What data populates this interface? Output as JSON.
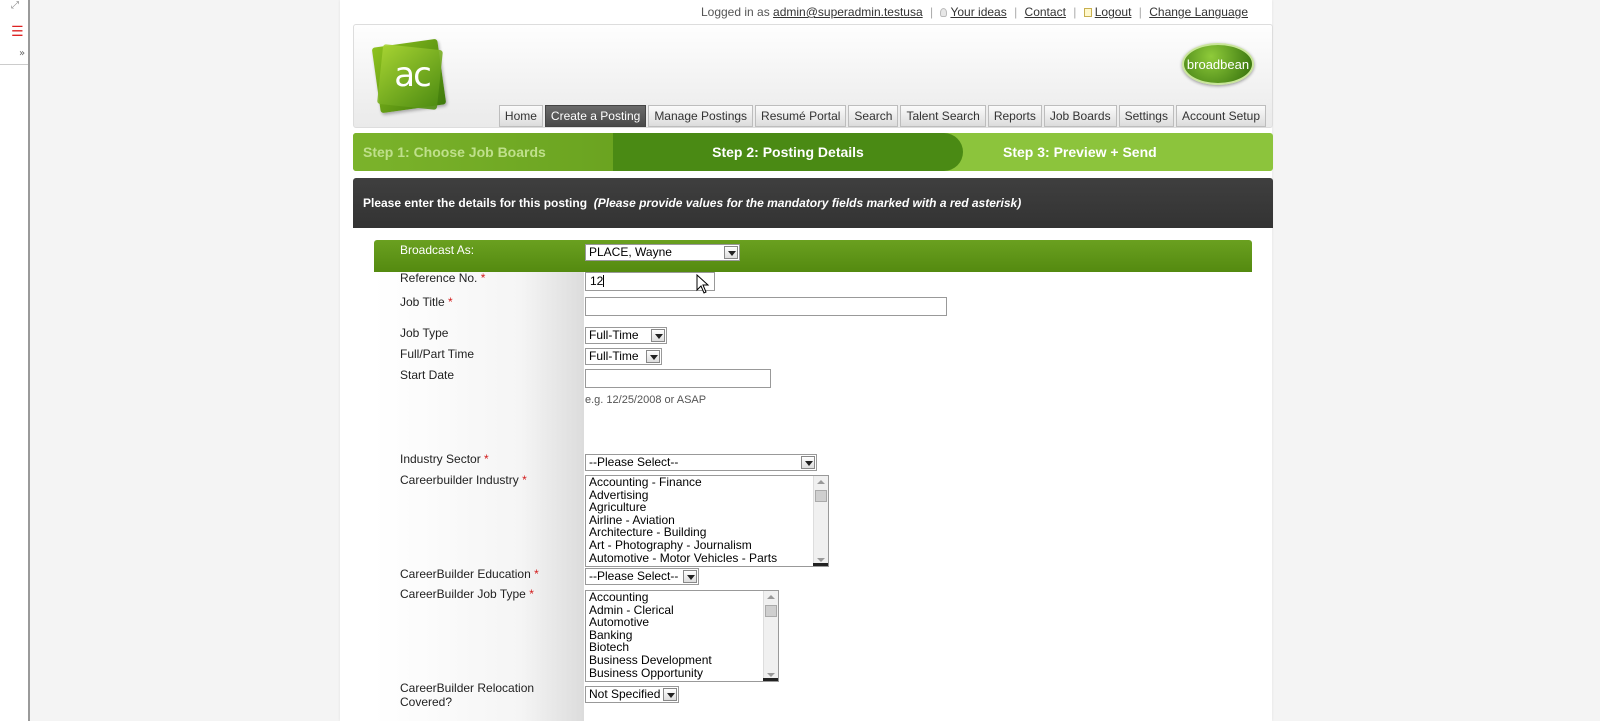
{
  "topbar": {
    "logged_in_prefix": "Logged in as",
    "user": "admin@superadmin.testusa",
    "your_ideas": "Your ideas",
    "contact": "Contact",
    "logout": "Logout",
    "change_language": "Change Language"
  },
  "logo": {
    "text": "ac"
  },
  "partner_logo": {
    "text": "broadbean"
  },
  "nav": {
    "tabs": [
      {
        "label": "Home"
      },
      {
        "label": "Create a Posting"
      },
      {
        "label": "Manage Postings"
      },
      {
        "label": "Resumé Portal"
      },
      {
        "label": "Search"
      },
      {
        "label": "Talent Search"
      },
      {
        "label": "Reports"
      },
      {
        "label": "Job Boards"
      },
      {
        "label": "Settings"
      },
      {
        "label": "Account Setup"
      }
    ],
    "active": "Create a Posting"
  },
  "steps": {
    "step1": "Step 1: Choose Job Boards",
    "step2": "Step 2: Posting Details",
    "step3": "Step 3: Preview + Send"
  },
  "instructions": {
    "main": "Please enter the details for this posting",
    "note": "(Please provide values for the mandatory fields marked with a red asterisk)"
  },
  "form": {
    "broadcast_as": {
      "label": "Broadcast As:",
      "value": "PLACE, Wayne"
    },
    "reference_no": {
      "label": "Reference No.",
      "value": "12"
    },
    "job_title": {
      "label": "Job Title",
      "value": ""
    },
    "job_type": {
      "label": "Job Type",
      "value": "Full-Time"
    },
    "full_part_time": {
      "label": "Full/Part Time",
      "value": "Full-Time"
    },
    "start_date": {
      "label": "Start Date",
      "value": "",
      "hint": "e.g. 12/25/2008 or ASAP"
    },
    "industry_sector": {
      "label": "Industry Sector",
      "value": "--Please Select--"
    },
    "cb_industry": {
      "label": "Careerbuilder Industry",
      "options": [
        "Accounting - Finance",
        "Advertising",
        "Agriculture",
        "Airline - Aviation",
        "Architecture - Building",
        "Art - Photography - Journalism",
        "Automotive - Motor Vehicles - Parts"
      ]
    },
    "cb_education": {
      "label": "CareerBuilder Education",
      "value": "--Please Select--"
    },
    "cb_job_type": {
      "label": "CareerBuilder Job Type",
      "options": [
        "Accounting",
        "Admin - Clerical",
        "Automotive",
        "Banking",
        "Biotech",
        "Business Development",
        "Business Opportunity"
      ]
    },
    "cb_relocation": {
      "label_line1": "CareerBuilder Relocation",
      "label_line2": "Covered?",
      "value": "Not Specified"
    },
    "required_mark": "*"
  },
  "colors": {
    "brand_green": "#6aa020",
    "dark_bar": "#3a3a3a",
    "required": "#d21a1a"
  }
}
